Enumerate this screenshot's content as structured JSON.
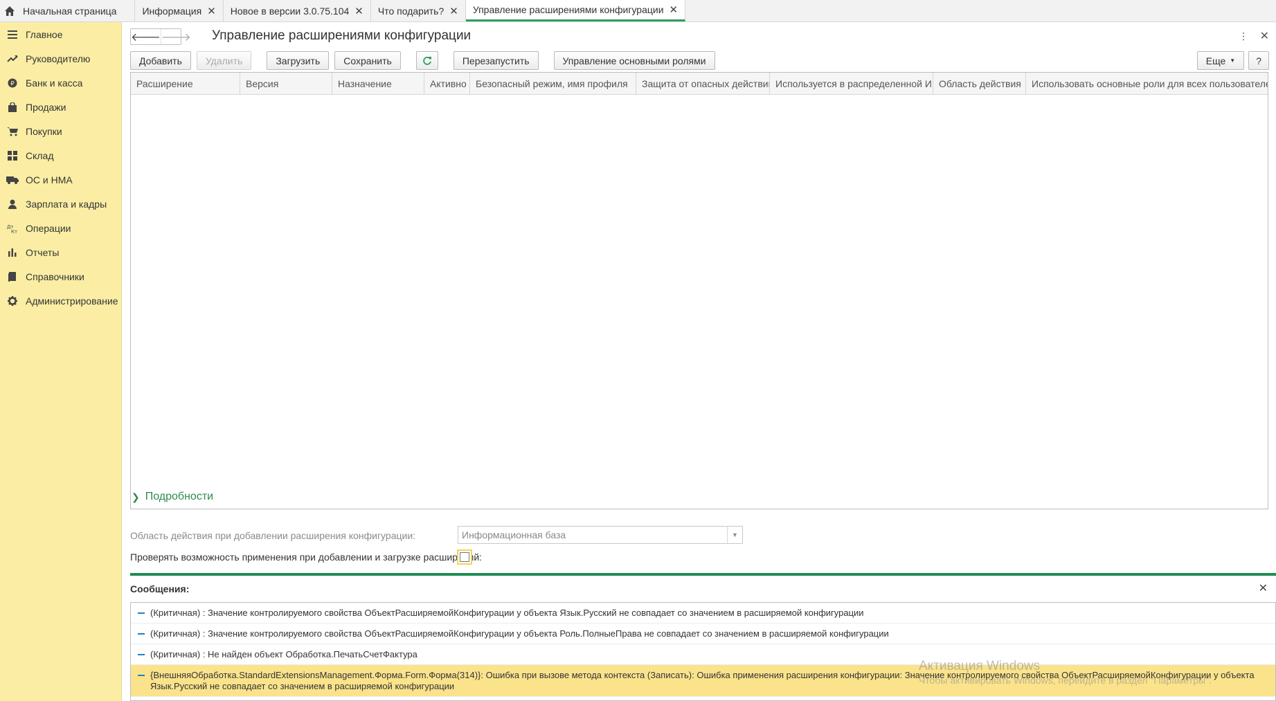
{
  "tabs": [
    {
      "label": "Начальная страница",
      "closable": false,
      "active": false
    },
    {
      "label": "Информация",
      "closable": true,
      "active": false
    },
    {
      "label": "Новое в версии 3.0.75.104",
      "closable": true,
      "active": false
    },
    {
      "label": "Что подарить?",
      "closable": true,
      "active": false
    },
    {
      "label": "Управление расширениями конфигурации",
      "closable": true,
      "active": true
    }
  ],
  "tab_close_glyph": "✕",
  "sidebar": {
    "items": [
      {
        "label": "Главное",
        "icon": "menu-icon"
      },
      {
        "label": "Руководителю",
        "icon": "trend-icon"
      },
      {
        "label": "Банк и касса",
        "icon": "coin-icon"
      },
      {
        "label": "Продажи",
        "icon": "bag-icon"
      },
      {
        "label": "Покупки",
        "icon": "cart-icon"
      },
      {
        "label": "Склад",
        "icon": "grid-icon"
      },
      {
        "label": "ОС и НМА",
        "icon": "truck-icon"
      },
      {
        "label": "Зарплата и кадры",
        "icon": "person-icon"
      },
      {
        "label": "Операции",
        "icon": "dt-kt-icon"
      },
      {
        "label": "Отчеты",
        "icon": "bar-chart-icon"
      },
      {
        "label": "Справочники",
        "icon": "book-icon"
      },
      {
        "label": "Администрирование",
        "icon": "gear-icon"
      }
    ]
  },
  "form": {
    "title": "Управление расширениями конфигурации",
    "more_glyph": "⋮",
    "close_glyph": "✕",
    "nav_back": "🡐",
    "nav_forward": "🡒",
    "toolbar": {
      "add": "Добавить",
      "delete": "Удалить",
      "load": "Загрузить",
      "save": "Сохранить",
      "restart": "Перезапустить",
      "manage_roles": "Управление основными ролями",
      "more": "Еще",
      "help": "?"
    },
    "table": {
      "columns": [
        "Расширение",
        "Версия",
        "Назначение",
        "Активно",
        "Безопасный режим, имя профиля",
        "Защита от опасных действий",
        "Используется в распределенной ИБ",
        "Область действия",
        "Использовать основные роли для всех пользователей"
      ],
      "rows": []
    },
    "details_label": "Подробности",
    "scope_label": "Область действия при добавлении расширения конфигурации:",
    "scope_value": "Информационная база",
    "check_label": "Проверять возможность применения при добавлении и загрузке расширений:"
  },
  "messages": {
    "title": "Сообщения:",
    "close_glyph": "✕",
    "items": [
      {
        "text": "(Критичная) : Значение контролируемого свойства ОбъектРасширяемойКонфигурации у объекта Язык.Русский не совпадает со значением в расширяемой конфигурации",
        "highlight": false
      },
      {
        "text": "(Критичная) : Значение контролируемого свойства ОбъектРасширяемойКонфигурации у объекта Роль.ПолныеПрава не совпадает со значением в расширяемой конфигурации",
        "highlight": false
      },
      {
        "text": "(Критичная) : Не найден объект Обработка.ПечатьСчетФактура",
        "highlight": false
      },
      {
        "text": "{ВнешняяОбработка.StandardExtensionsManagement.Форма.Form.Форма(314)}: Ошибка при вызове метода контекста (Записать): Ошибка применения расширения конфигурации: Значение контролируемого свойства ОбъектРасширяемойКонфигурации у объекта Язык.Русский не совпадает со значением в расширяемой конфигурации",
        "highlight": true
      }
    ]
  },
  "watermark": {
    "line1": "Активация Windows",
    "line2": "Чтобы активировать Windows, перейдите в раздел \"Параметры\"."
  },
  "colors": {
    "sidebar_bg": "#fbeea4",
    "accent_green": "#1e8c52",
    "highlight_row": "#fbe38c"
  }
}
